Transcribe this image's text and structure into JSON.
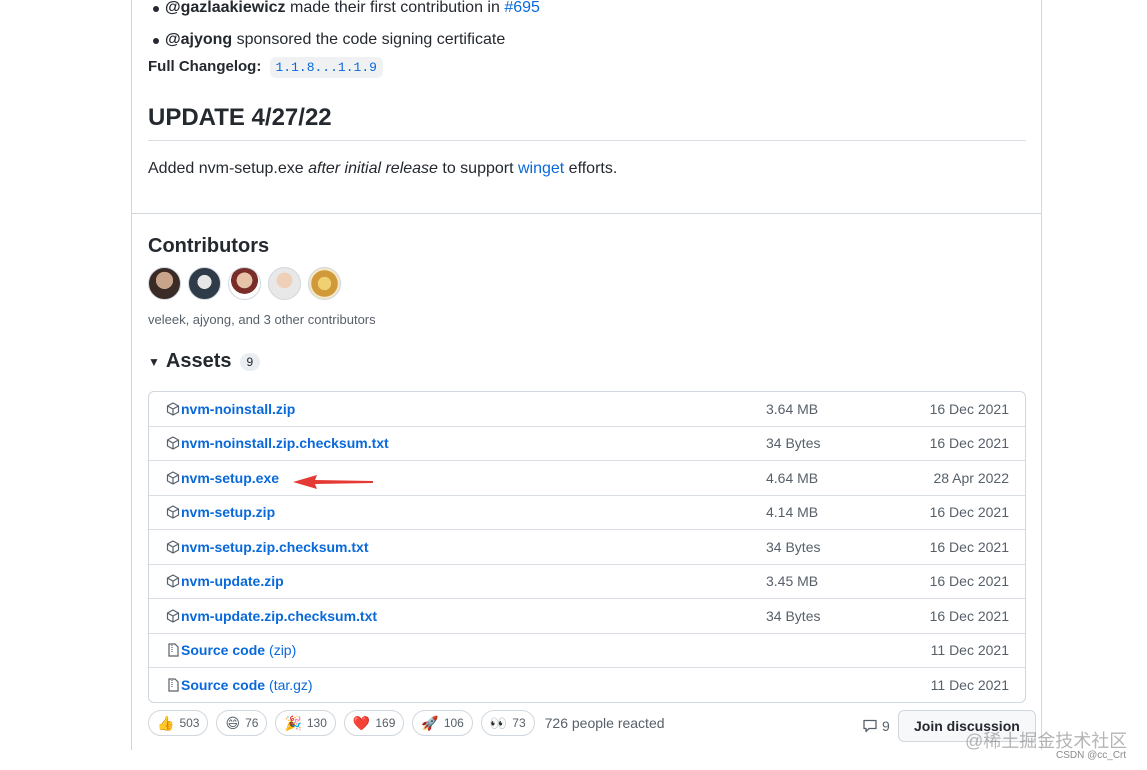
{
  "top_bullets": [
    {
      "user": "@gazlaakiewicz",
      "text": " made their first contribution in ",
      "link": "#695"
    },
    {
      "user": "@ajyong",
      "text": " sponsored the code signing certificate",
      "link": ""
    }
  ],
  "changelog": {
    "label": "Full Changelog:",
    "code": "1.1.8...1.1.9"
  },
  "update": {
    "title": "UPDATE 4/27/22",
    "text_before": "Added nvm-setup.exe ",
    "text_italic": "after initial release",
    "text_mid": " to support ",
    "link": "winget",
    "text_after": " efforts."
  },
  "contributors": {
    "title": "Contributors",
    "summary": "veleek, ajyong, and 3 other contributors"
  },
  "assets": {
    "title": "Assets",
    "count": "9",
    "rows": [
      {
        "name": "nvm-noinstall.zip",
        "size": "3.64 MB",
        "date": "16 Dec 2021",
        "icon": "package-icon"
      },
      {
        "name": "nvm-noinstall.zip.checksum.txt",
        "size": "34 Bytes",
        "date": "16 Dec 2021",
        "icon": "package-icon"
      },
      {
        "name": "nvm-setup.exe",
        "size": "4.64 MB",
        "date": "28 Apr 2022",
        "icon": "package-icon"
      },
      {
        "name": "nvm-setup.zip",
        "size": "4.14 MB",
        "date": "16 Dec 2021",
        "icon": "package-icon"
      },
      {
        "name": "nvm-setup.zip.checksum.txt",
        "size": "34 Bytes",
        "date": "16 Dec 2021",
        "icon": "package-icon"
      },
      {
        "name": "nvm-update.zip",
        "size": "3.45 MB",
        "date": "16 Dec 2021",
        "icon": "package-icon"
      },
      {
        "name": "nvm-update.zip.checksum.txt",
        "size": "34 Bytes",
        "date": "16 Dec 2021",
        "icon": "package-icon"
      },
      {
        "name": "Source code",
        "suffix": "(zip)",
        "size": "",
        "date": "11 Dec 2021",
        "icon": "file-zip-icon"
      },
      {
        "name": "Source code",
        "suffix": "(tar.gz)",
        "size": "",
        "date": "11 Dec 2021",
        "icon": "file-zip-icon"
      }
    ]
  },
  "reactions": {
    "items": [
      {
        "emoji": "👍",
        "count": "503"
      },
      {
        "emoji": "😄",
        "count": "76"
      },
      {
        "emoji": "🎉",
        "count": "130"
      },
      {
        "emoji": "❤️",
        "count": "169"
      },
      {
        "emoji": "🚀",
        "count": "106"
      },
      {
        "emoji": "👀",
        "count": "73"
      }
    ],
    "summary": "726 people reacted"
  },
  "discussion": {
    "count": "9",
    "button": "Join discussion"
  },
  "watermark": {
    "line1": "@稀土掘金技术社区",
    "line2": "CSDN @cc_Crt"
  },
  "colors": {
    "link": "#0969da",
    "arrow": "#e53935",
    "border": "#d0d7de"
  }
}
